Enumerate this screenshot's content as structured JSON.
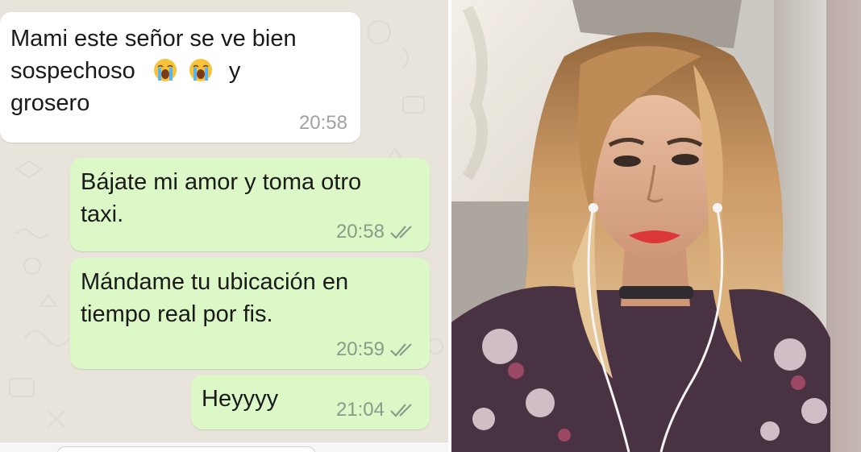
{
  "chat": {
    "messages": [
      {
        "direction": "incoming",
        "line1": "Mami este señor se ve bien",
        "line2_before": "sospechoso",
        "emoji": [
          "loudly-crying-face",
          "loudly-crying-face"
        ],
        "line2_after": "y",
        "line3": "grosero",
        "time": "20:58"
      },
      {
        "direction": "outgoing",
        "text": "Bájate mi amor y toma otro\ntaxi.",
        "time": "20:58",
        "status": "double-check-read"
      },
      {
        "direction": "outgoing",
        "text": "Mándame tu ubicación en\ntiempo real por fis.",
        "time": "20:59",
        "status": "double-check-read"
      },
      {
        "direction": "outgoing",
        "text": "Heyyyy",
        "time": "21:04",
        "status": "double-check-read"
      }
    ],
    "colors": {
      "wallpaper": "#e9e4db",
      "incoming_bubble": "#ffffff",
      "outgoing_bubble": "#dcf8c6",
      "timestamp": "#8c9a89"
    }
  },
  "photo": {
    "subject": "selfie-photo",
    "colors": {
      "hair": "#c9935a",
      "lips": "#d8262a",
      "blouse": "#3a2232"
    }
  }
}
